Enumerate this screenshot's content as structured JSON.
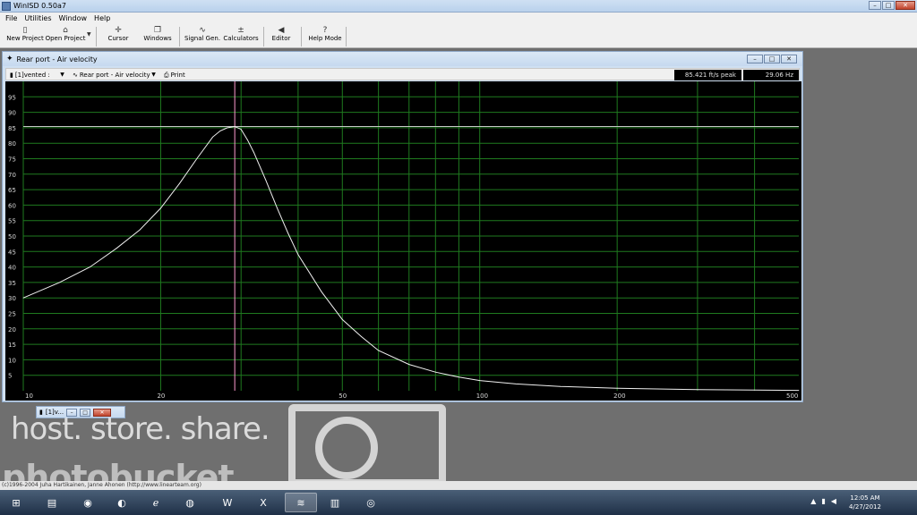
{
  "app": {
    "title": "WinISD 0.50a7",
    "window_controls": [
      "–",
      "□",
      "✕"
    ]
  },
  "menu": [
    "File",
    "Utilities",
    "Window",
    "Help"
  ],
  "toolbar": {
    "new_project": "New Project",
    "open_project": "Open Project",
    "cursor": "Cursor",
    "windows": "Windows",
    "signal_gen": "Signal Gen.",
    "calculators": "Calculators",
    "editor": "Editor",
    "help_mode": "Help Mode"
  },
  "child_window": {
    "title": "Rear port - Air velocity",
    "project_selector": "[1]vented :",
    "graph_selector": "Rear port - Air velocity",
    "print": "Print",
    "peak_readout": "85.421 ft/s peak",
    "freq_readout": "29.06 Hz"
  },
  "minimized_window": {
    "title": "[1]v..."
  },
  "status_text": "(c)1996-2004 Juha Hartikainen, Janne Ahonen (http://www.linearteam.org)",
  "watermark": {
    "line1": "host. store. share.",
    "line2": "photobucket"
  },
  "clock": {
    "time": "12:05 AM",
    "date": "4/27/2012"
  },
  "chart_data": {
    "type": "line",
    "xscale": "log",
    "xlim": [
      10,
      500
    ],
    "ylim": [
      0,
      100
    ],
    "y_ticks": [
      5,
      10,
      15,
      20,
      25,
      30,
      35,
      40,
      45,
      50,
      55,
      60,
      65,
      70,
      75,
      80,
      85,
      90,
      95
    ],
    "x_tick_labels": [
      {
        "value": 10,
        "label": "10"
      },
      {
        "value": 20,
        "label": "20"
      },
      {
        "value": 50,
        "label": "50"
      },
      {
        "value": 100,
        "label": "100"
      },
      {
        "value": 200,
        "label": "200"
      },
      {
        "value": 500,
        "label": "500"
      }
    ],
    "x_gridlines": [
      20,
      30,
      40,
      50,
      60,
      70,
      80,
      90,
      100,
      200,
      300,
      400
    ],
    "cursor_x": 29.06,
    "peak_line_y": 85.421,
    "colors": {
      "background": "#000000",
      "grid": "#1f7a1f",
      "curve": "#f0f0f0",
      "cursor": "#ff9ad0",
      "peak_line": "#c8c8c8",
      "tick_label": "#d8d8d8"
    },
    "series": [
      {
        "x": [
          10,
          12,
          14,
          16,
          18,
          20,
          22,
          24,
          26,
          27,
          28,
          29.06,
          30,
          31,
          32,
          34,
          36,
          38,
          40,
          45,
          50,
          55,
          60,
          70,
          80,
          90,
          100,
          120,
          150,
          200,
          300,
          400,
          500
        ],
        "y": [
          30,
          35,
          40,
          46,
          52,
          59,
          67,
          75,
          82,
          84,
          85,
          85.4,
          84.5,
          81,
          77,
          68,
          59,
          51,
          44,
          32,
          23,
          17.5,
          13,
          8.5,
          6,
          4.4,
          3.3,
          2.2,
          1.4,
          0.8,
          0.35,
          0.2,
          0.12
        ]
      }
    ]
  }
}
